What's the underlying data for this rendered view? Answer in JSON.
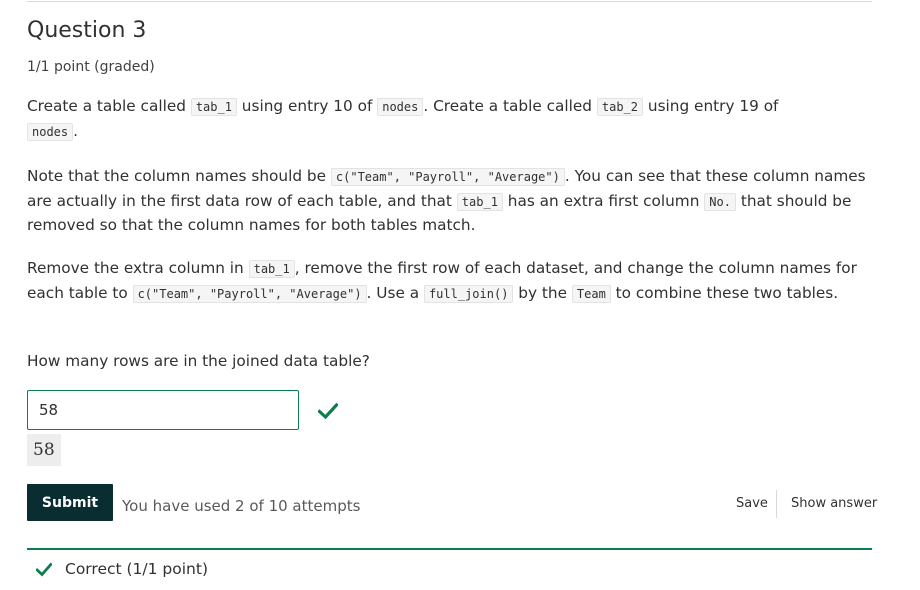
{
  "problem": {
    "title": "Question 3",
    "points": "1/1 point (graded)",
    "p1": {
      "t1": "Create a table called ",
      "c1": "tab_1",
      "t2": " using entry 10 of ",
      "c2": "nodes",
      "t3": ". Create a table called ",
      "c3": "tab_2",
      "t4": " using entry 19 of ",
      "c4": "nodes",
      "t5": "."
    },
    "p2": {
      "t1": "Note that the column names should be ",
      "c1": "c(\"Team\", \"Payroll\", \"Average\")",
      "t2": ". You can see that these column names are actually in the first data row of each table, and that ",
      "c2": "tab_1",
      "t3": " has an extra first column ",
      "c3": "No.",
      "t4": " that should be removed so that the column names for both tables match."
    },
    "p3": {
      "t1": "Remove the extra column in ",
      "c1": "tab_1",
      "t2": ", remove the first row of each dataset, and change the column names for each table to ",
      "c2": "c(\"Team\", \"Payroll\", \"Average\")",
      "t3": ". Use a ",
      "c3": "full_join()",
      "t4": " by the ",
      "c4": "Team",
      "t5": " to combine these two tables."
    },
    "question": "How many rows are in the joined data table?"
  },
  "answer": {
    "value": "58",
    "echo": "58",
    "status_icon": "checkmark-icon",
    "status_color": "#0d7d4d"
  },
  "actions": {
    "submit_label": "Submit",
    "attempts_text": "You have used 2 of 10 attempts",
    "save_label": "Save",
    "show_answer_label": "Show answer"
  },
  "feedback": {
    "icon": "checkmark-icon",
    "text": "Correct (1/1 point)",
    "color": "#0d7d4d"
  },
  "colors": {
    "submit_bg": "#0a2d32",
    "correct": "#0d7d4d"
  }
}
